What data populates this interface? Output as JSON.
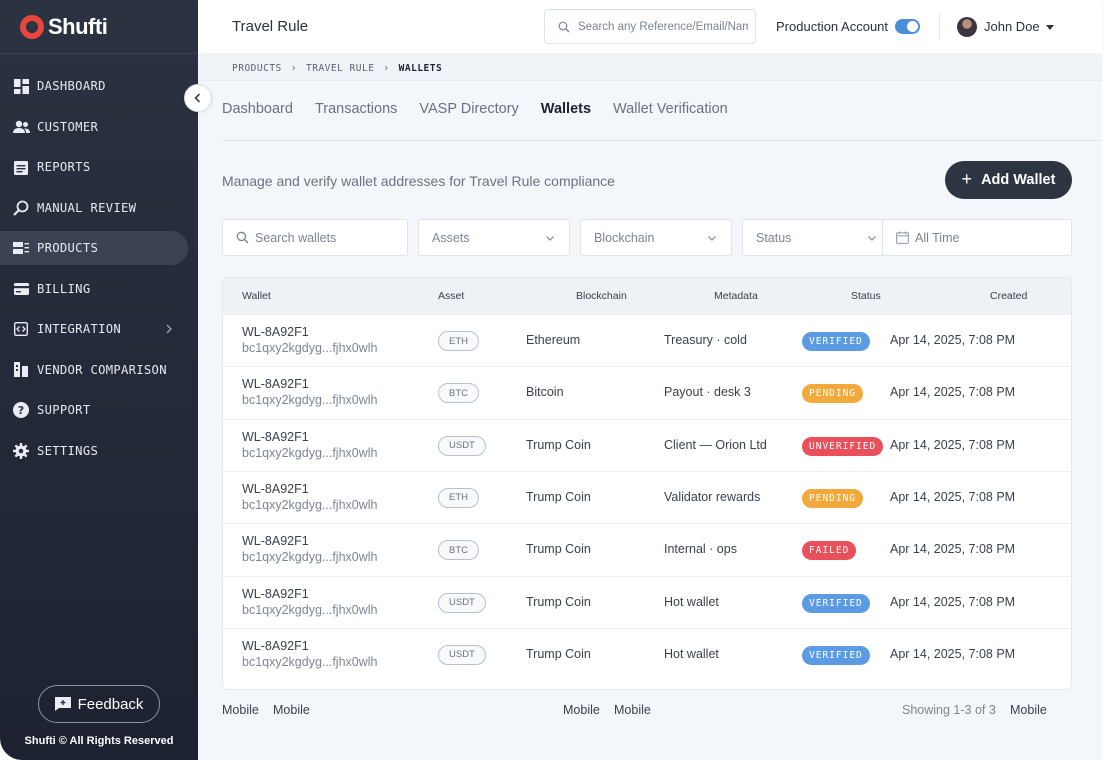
{
  "brand": {
    "name": "Shufti",
    "copyright": "Shufti © All Rights Reserved",
    "feedback_label": "Feedback"
  },
  "sidebar": {
    "items": [
      {
        "label": "DASHBOARD",
        "icon": "dashboard-icon",
        "active": false
      },
      {
        "label": "CUSTOMER",
        "icon": "users-icon",
        "active": false
      },
      {
        "label": "REPORTS",
        "icon": "reports-icon",
        "active": false
      },
      {
        "label": "MANUAL REVIEW",
        "icon": "search-icon",
        "active": false
      },
      {
        "label": "PRODUCTS",
        "icon": "products-icon",
        "active": true
      },
      {
        "label": "BILLING",
        "icon": "card-icon",
        "active": false
      },
      {
        "label": "INTEGRATION",
        "icon": "code-icon",
        "active": false,
        "has_submenu": true
      },
      {
        "label": "VENDOR COMPARISON",
        "icon": "compare-icon",
        "active": false
      },
      {
        "label": "SUPPORT",
        "icon": "help-icon",
        "active": false
      },
      {
        "label": "SETTINGS",
        "icon": "gear-icon",
        "active": false
      }
    ]
  },
  "header": {
    "title": "Travel Rule",
    "search_placeholder": "Search any Reference/Email/Name",
    "account_label": "Production Account",
    "account_enabled": true,
    "user_name": "John Doe"
  },
  "breadcrumb": [
    "PRODUCTS",
    "TRAVEL RULE",
    "WALLETS"
  ],
  "tabs": [
    "Dashboard",
    "Transactions",
    "VASP Directory",
    "Wallets",
    "Wallet Verification"
  ],
  "active_tab": "Wallets",
  "subtitle": "Manage and verify wallet addresses for Travel Rule compliance",
  "add_button": "Add Wallet",
  "filters": {
    "search_placeholder": "Search wallets",
    "assets": "Assets",
    "blockchain": "Blockchain",
    "status": "Status",
    "date": "All Time"
  },
  "table": {
    "columns": [
      "Wallet",
      "Asset",
      "Blockchain",
      "Metadata",
      "Status",
      "Created"
    ],
    "rows": [
      {
        "id": "WL-8A92F1",
        "address": "bc1qxy2kgdyg...fjhx0wlh",
        "asset": "ETH",
        "chain": "Ethereum",
        "meta": "Treasury · cold",
        "status": "VERIFIED",
        "created": "Apr 14, 2025, 7:08 PM"
      },
      {
        "id": "WL-8A92F1",
        "address": "bc1qxy2kgdyg...fjhx0wlh",
        "asset": "BTC",
        "chain": "Bitcoin",
        "meta": "Payout · desk 3",
        "status": "PENDING",
        "created": "Apr 14, 2025, 7:08 PM"
      },
      {
        "id": "WL-8A92F1",
        "address": "bc1qxy2kgdyg...fjhx0wlh",
        "asset": "USDT",
        "chain": "Trump Coin",
        "meta": "Client — Orion Ltd",
        "status": "UNVERIFIED",
        "created": "Apr 14, 2025, 7:08 PM"
      },
      {
        "id": "WL-8A92F1",
        "address": "bc1qxy2kgdyg...fjhx0wlh",
        "asset": "ETH",
        "chain": "Trump Coin",
        "meta": "Validator rewards",
        "status": "PENDING",
        "created": "Apr 14, 2025, 7:08 PM"
      },
      {
        "id": "WL-8A92F1",
        "address": "bc1qxy2kgdyg...fjhx0wlh",
        "asset": "BTC",
        "chain": "Trump Coin",
        "meta": "Internal · ops",
        "status": "FAILED",
        "created": "Apr 14, 2025, 7:08 PM"
      },
      {
        "id": "WL-8A92F1",
        "address": "bc1qxy2kgdyg...fjhx0wlh",
        "asset": "USDT",
        "chain": "Trump Coin",
        "meta": "Hot wallet",
        "status": "VERIFIED",
        "created": "Apr 14, 2025, 7:08 PM"
      },
      {
        "id": "WL-8A92F1",
        "address": "bc1qxy2kgdyg...fjhx0wlh",
        "asset": "USDT",
        "chain": "Trump Coin",
        "meta": "Hot wallet",
        "status": "VERIFIED",
        "created": "Apr 14, 2025, 7:08 PM"
      }
    ]
  },
  "status_colors": {
    "VERIFIED": "#5b9be3",
    "PENDING": "#f2a93b",
    "UNVERIFIED": "#e8505b",
    "FAILED": "#e8505b"
  },
  "footer": {
    "labels": [
      "Mobile",
      "Mobile",
      "Mobile",
      "Mobile",
      "Mobile"
    ],
    "showing": "Showing 1-3 of 3"
  }
}
